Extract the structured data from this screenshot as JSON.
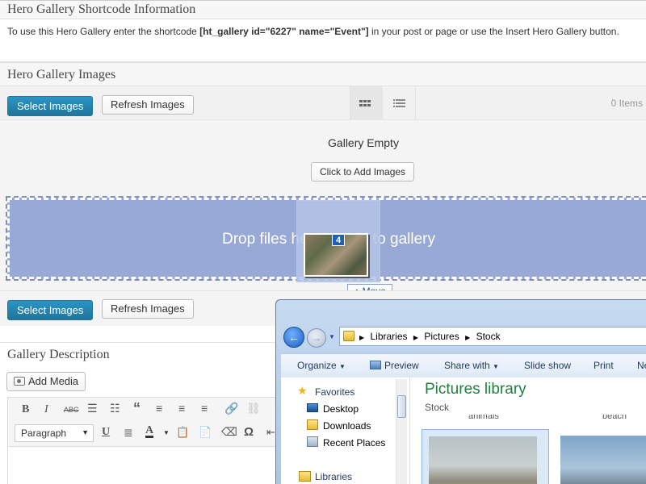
{
  "shortcode_panel": {
    "title": "Hero Gallery Shortcode Information",
    "text_before": "To use this Hero Gallery enter the shortcode ",
    "shortcode": "[ht_gallery id=\"6227\" name=\"Event\"]",
    "text_after": " in your post or page or use the Insert Hero Gallery button."
  },
  "images_panel": {
    "title": "Hero Gallery Images",
    "select_button": "Select Images",
    "refresh_button": "Refresh Images",
    "items_count": "0 Items",
    "empty_text": "Gallery Empty",
    "add_button": "Click to Add Images",
    "drop_text": "Drop files here to add to gallery",
    "select_button_bottom": "Select Images",
    "refresh_button_bottom": "Refresh Images"
  },
  "drag": {
    "badge": "4",
    "tooltip": "Move"
  },
  "description_panel": {
    "title": "Gallery Description",
    "add_media": "Add Media",
    "format_select": "Paragraph"
  },
  "explorer": {
    "breadcrumb": [
      "Libraries",
      "Pictures",
      "Stock"
    ],
    "commands": [
      "Organize",
      "Preview",
      "Share with",
      "Slide show",
      "Print",
      "Ne"
    ],
    "nav": {
      "favorites_label": "Favorites",
      "items": [
        "Desktop",
        "Downloads",
        "Recent Places"
      ],
      "libraries_label": "Libraries"
    },
    "library_title": "Pictures library",
    "library_sub": "Stock",
    "thumb_labels": [
      "animals",
      "beach"
    ]
  },
  "colors": {
    "accent": "#21759b",
    "dropzone": "#97a9d4",
    "explorer_title": "#1e7f3e"
  }
}
